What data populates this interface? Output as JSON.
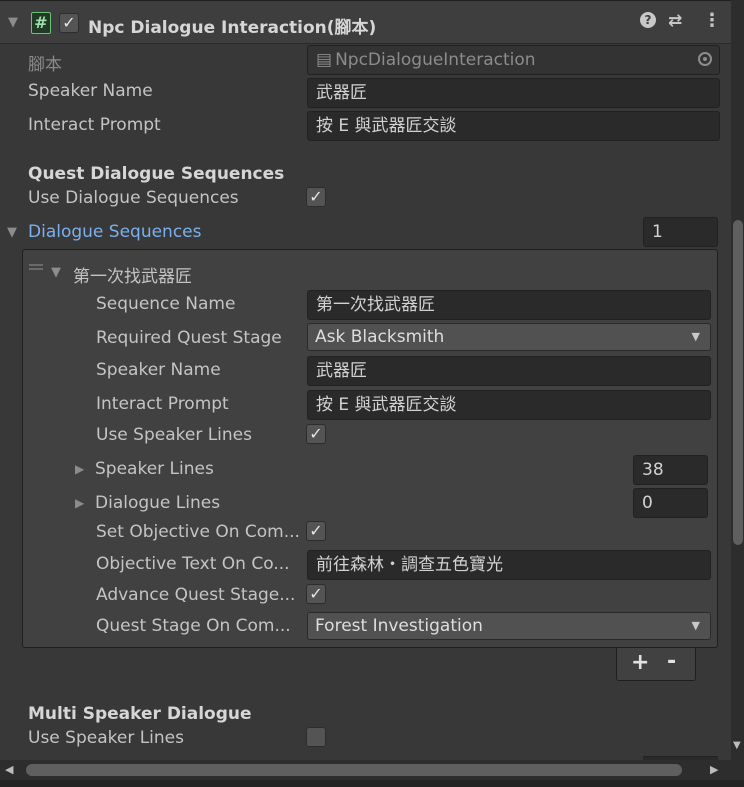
{
  "header": {
    "title": "Npc Dialogue Interaction(腳本)",
    "enabled": true,
    "icons": [
      "foldout-arrow-icon",
      "script-icon",
      "help-icon",
      "preset-icon",
      "kebab-menu-icon"
    ]
  },
  "script_field": {
    "label": "腳本",
    "value": "NpcDialogueInteraction"
  },
  "fields": {
    "speaker_name_label": "Speaker Name",
    "speaker_name_value": "武器匠",
    "interact_prompt_label": "Interact Prompt",
    "interact_prompt_value": "按 E 與武器匠交談"
  },
  "quest_section": {
    "header": "Quest Dialogue Sequences",
    "use_sequences_label": "Use Dialogue Sequences",
    "use_sequences_checked": true,
    "sequences_label": "Dialogue Sequences",
    "sequences_count": "1"
  },
  "sequence": {
    "title": "第一次找武器匠",
    "sequence_name_label": "Sequence Name",
    "sequence_name_value": "第一次找武器匠",
    "required_stage_label": "Required Quest Stage",
    "required_stage_value": "Ask Blacksmith",
    "speaker_name_label": "Speaker Name",
    "speaker_name_value": "武器匠",
    "interact_prompt_label": "Interact Prompt",
    "interact_prompt_value": "按 E 與武器匠交談",
    "use_speaker_lines_label": "Use Speaker Lines",
    "use_speaker_lines_checked": true,
    "speaker_lines_label": "Speaker Lines",
    "speaker_lines_count": "38",
    "dialogue_lines_label": "Dialogue Lines",
    "dialogue_lines_count": "0",
    "set_objective_label": "Set Objective On Com...",
    "set_objective_checked": true,
    "objective_text_label": "Objective Text On Co...",
    "objective_text_value": "前往森林・調查五色寶光",
    "advance_stage_label": "Advance Quest Stage...",
    "advance_stage_checked": true,
    "quest_stage_label": "Quest Stage On Com...",
    "quest_stage_value": "Forest Investigation"
  },
  "list_buttons": {
    "add": "+",
    "remove": "-"
  },
  "multi_section": {
    "header": "Multi Speaker Dialogue",
    "use_speaker_lines_label": "Use Speaker Lines",
    "use_speaker_lines_checked": false
  },
  "colors": {
    "background": "#383838",
    "field_bg": "#2a2a2a",
    "foldout_link": "#7bb0ef",
    "script_icon": "#6fbf7c"
  }
}
